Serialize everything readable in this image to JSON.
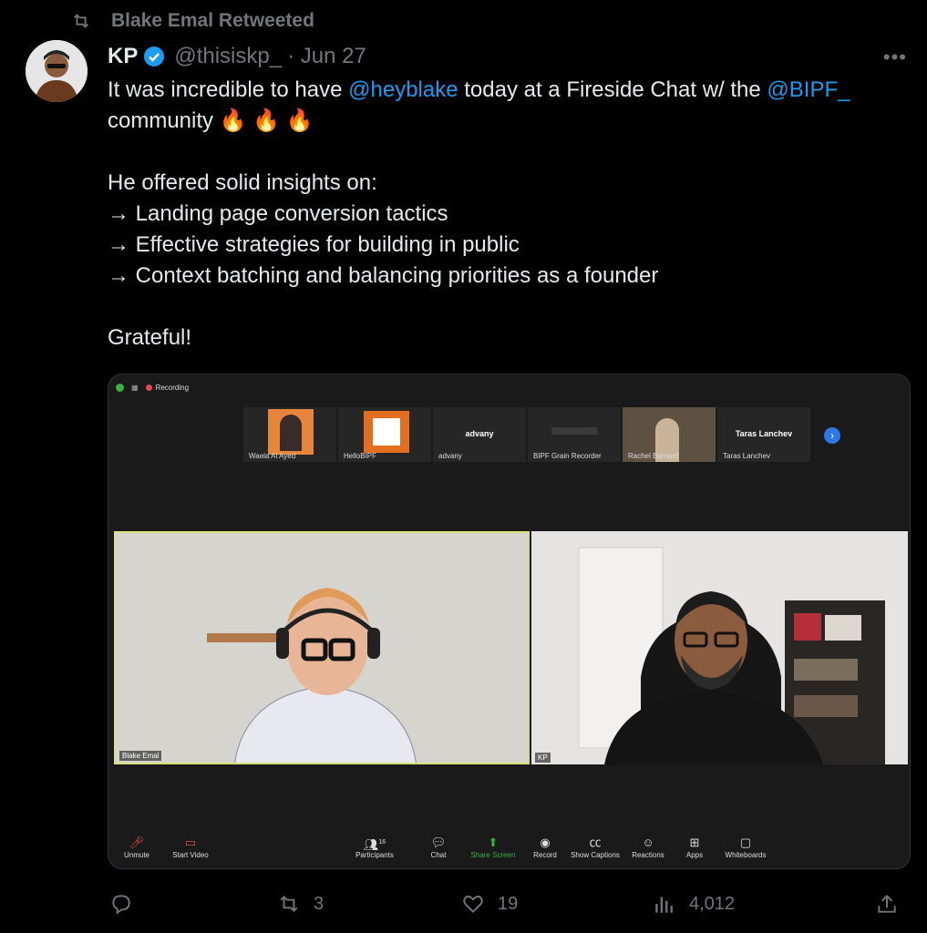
{
  "retweet": {
    "label": "Blake Emal Retweeted"
  },
  "author": {
    "name": "KP",
    "handle": "@thisiskp_",
    "date": "· Jun 27"
  },
  "tweet": {
    "line1_pre": "It was incredible to have ",
    "mention1": "@heyblake",
    "line1_mid": " today at a Fireside Chat w/ the ",
    "mention2": "@BIPF_",
    "line2": "community 🔥 🔥 🔥",
    "line3": "He offered solid insights on:",
    "bullet1": "→ Landing page conversion tactics",
    "bullet2": "→ Effective strategies for building in public",
    "bullet3": "→ Context batching and balancing priorities as a founder",
    "line4": "Grateful!"
  },
  "media": {
    "recording_label": "Recording",
    "participants": [
      {
        "name": "Waela Al Ayed"
      },
      {
        "name": "HelloBIPF"
      },
      {
        "name": "advany",
        "title": "advany"
      },
      {
        "name": "BIPF Grain Recorder"
      },
      {
        "name": "Rachel Barnard"
      },
      {
        "name": "Taras Lanchev",
        "title": "Taras Lanchev"
      }
    ],
    "speaker_left": "Blake Emal",
    "speaker_right": "KP",
    "toolbar": {
      "unmute": "Unmute",
      "start_video": "Start Video",
      "participants": "Participants",
      "participants_count": "16",
      "chat": "Chat",
      "share_screen": "Share Screen",
      "record": "Record",
      "show_captions": "Show Captions",
      "reactions": "Reactions",
      "apps": "Apps",
      "whiteboards": "Whiteboards"
    }
  },
  "actions": {
    "retweets": "3",
    "likes": "19",
    "views": "4,012"
  },
  "colors": {
    "accent": "#1d9bf0",
    "muted": "#71767b",
    "background": "#000000"
  }
}
